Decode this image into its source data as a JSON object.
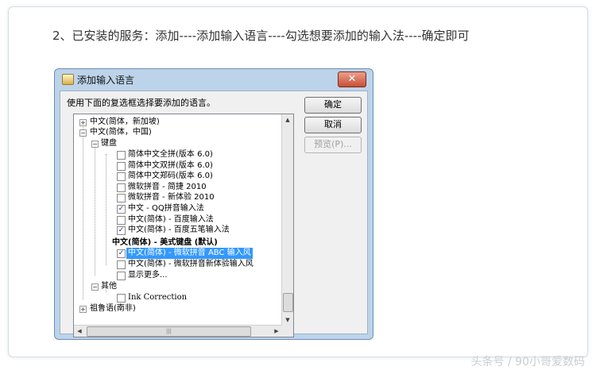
{
  "caption": "2、已安装的服务：添加----添加输入语言----勾选想要添加的输入法----确定即可",
  "watermark": "头条号 / 90小哥爱数码",
  "dialog": {
    "title": "添加输入语言",
    "close_glyph": "✕",
    "instruction": "使用下面的复选框选择要添加的语言。",
    "ok_label": "确定",
    "cancel_label": "取消",
    "preview_label": "预览(P)..."
  },
  "tree": {
    "lang_sg": "中文(简体，新加坡)",
    "lang_cn": "中文(简体，中国)",
    "keyboard": "键盘",
    "items": [
      {
        "label": "简体中文全拼(版本 6.0)",
        "checked": false
      },
      {
        "label": "简体中文双拼(版本 6.0)",
        "checked": false
      },
      {
        "label": "简体中文郑码(版本 6.0)",
        "checked": false
      },
      {
        "label": "微软拼音 - 简捷 2010",
        "checked": false
      },
      {
        "label": "微软拼音 - 新体验 2010",
        "checked": false
      },
      {
        "label": "中文 - QQ拼音输入法",
        "checked": true
      },
      {
        "label": "中文(简体) - 百度输入法",
        "checked": false
      },
      {
        "label": "中文(简体) - 百度五笔输入法",
        "checked": true
      }
    ],
    "default_keyboard": "中文(简体) - 美式键盘 (默认)",
    "items2": [
      {
        "label": "中文(简体) - 微软拼音 ABC 输入风",
        "checked": true,
        "selected": true
      },
      {
        "label": "中文(简体) - 微软拼音新体验输入风",
        "checked": false,
        "selected": false
      }
    ],
    "show_more": "显示更多...",
    "other": "其他",
    "ink": "Ink Correction",
    "lang_zulu": "祖鲁语(南非)",
    "check_glyph": "✓",
    "plus": "+",
    "minus": "−"
  }
}
